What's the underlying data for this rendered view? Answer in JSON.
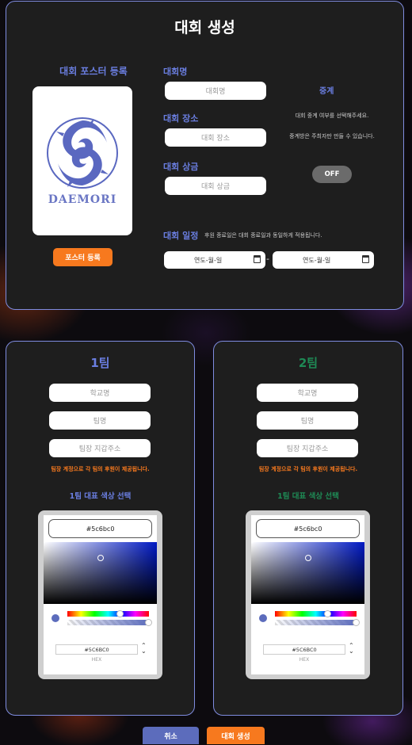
{
  "page": {
    "title": "대회 생성"
  },
  "poster": {
    "label": "대회 포스터 등록",
    "button": "포스터 등록",
    "logo_text": "DAEMORI"
  },
  "tournament": {
    "name_label": "대회명",
    "name_placeholder": "대회명",
    "place_label": "대회 장소",
    "place_placeholder": "대회 장소",
    "prize_label": "대회 상금",
    "prize_placeholder": "대회 상금",
    "schedule_label": "대회 일정",
    "schedule_note": "후원 종료일은 대회 종료일과 동일하게 적용됩니다.",
    "start_date": "연도-월-일",
    "end_date": "연도-월-일",
    "date_separator": "-"
  },
  "relay": {
    "label": "중계",
    "text1": "대회 중계 여부를 선택해주세요.",
    "text2": "중계방은 주최자만 만들 수 있습니다.",
    "toggle": "OFF"
  },
  "teams": [
    {
      "title": "1팀",
      "color": "#5c6cbc",
      "school_placeholder": "학교명",
      "team_placeholder": "팀명",
      "wallet_placeholder": "팀장 지갑주소",
      "note": "팀장 계정으로 각 팀의 후원이 제공됩니다.",
      "color_label": "1팀 대표 색상 선택",
      "hex_top": "#5c6bc0",
      "hex_value": "#5C6BC0",
      "hex_label": "HEX",
      "hue_position": 0.64
    },
    {
      "title": "2팀",
      "color": "#1e8a55",
      "school_placeholder": "학교명",
      "team_placeholder": "팀명",
      "wallet_placeholder": "팀장 지갑주소",
      "note": "팀장 계정으로 각 팀의 후원이 제공됩니다.",
      "color_label": "1팀 대표 색상 선택",
      "hex_top": "#5c6bc0",
      "hex_value": "#5C6BC0",
      "hex_label": "HEX",
      "hue_position": 0.64
    }
  ],
  "actions": {
    "cancel": "취소",
    "create": "대회 생성"
  },
  "colors": {
    "accent_blue": "#6a7ee0",
    "accent_orange": "#f7791e",
    "swatch": "#5c6cbc"
  }
}
